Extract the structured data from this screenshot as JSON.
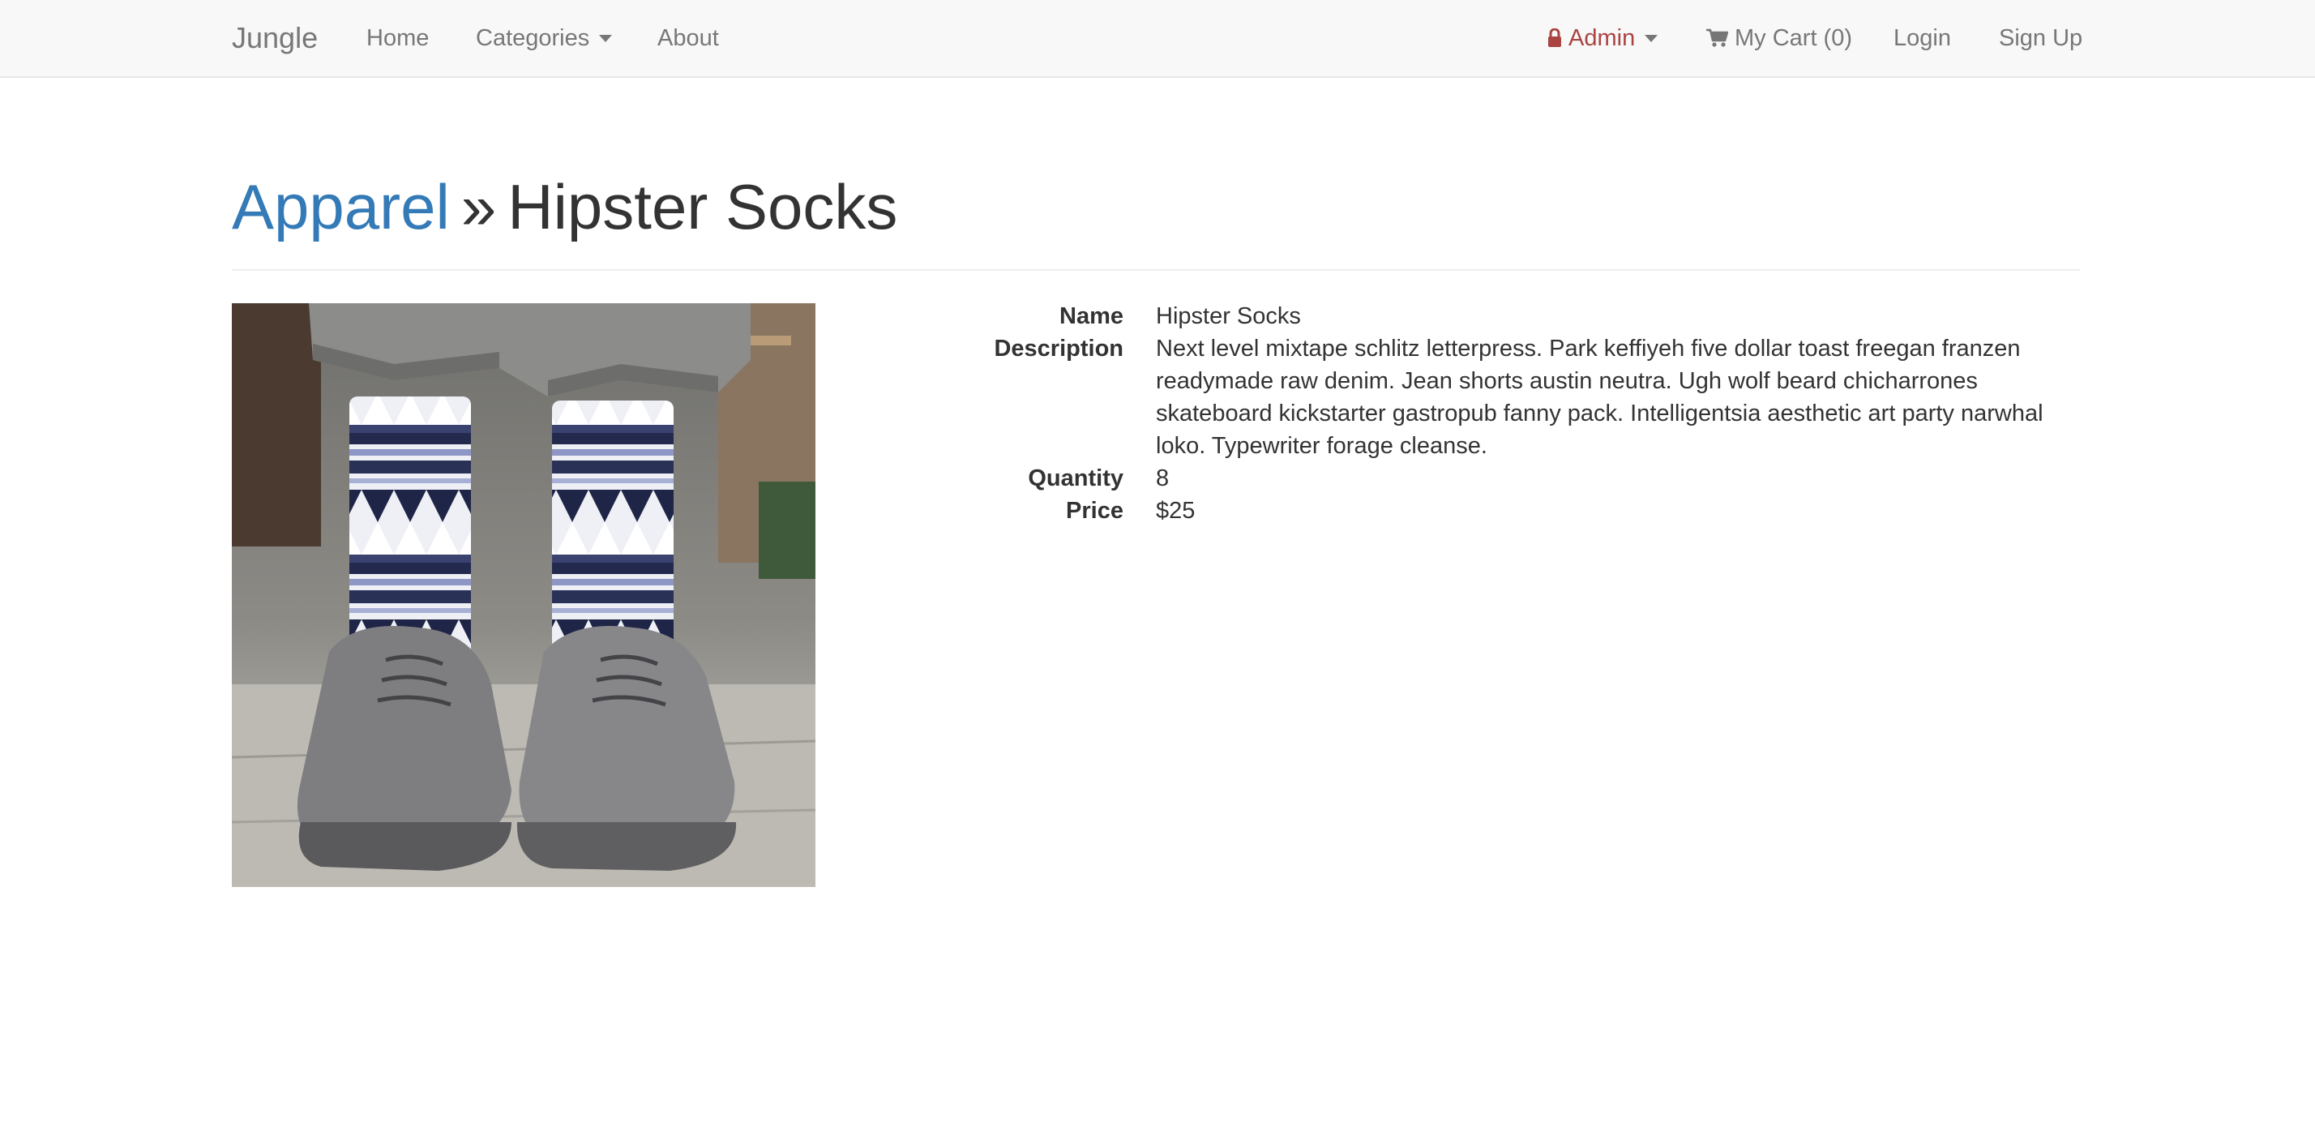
{
  "navbar": {
    "brand": "Jungle",
    "home": "Home",
    "categories": "Categories",
    "about": "About",
    "admin": "Admin",
    "cart": "My Cart (0)",
    "login": "Login",
    "signup": "Sign Up"
  },
  "breadcrumb": {
    "category": "Apparel",
    "separator": "»",
    "product": "Hipster Socks"
  },
  "product": {
    "image_alt": "Hipster Socks",
    "fields": [
      {
        "label": "Name",
        "value": "Hipster Socks"
      },
      {
        "label": "Description",
        "value": "Next level mixtape schlitz letterpress. Park keffiyeh five dollar toast freegan franzen readymade raw denim. Jean shorts austin neutra. Ugh wolf beard chicharrones skateboard kickstarter gastropub fanny pack. Intelligentsia aesthetic art party narwhal loko. Typewriter forage cleanse."
      },
      {
        "label": "Quantity",
        "value": "8"
      },
      {
        "label": "Price",
        "value": "$25"
      }
    ]
  },
  "icons": {
    "lock": "lock-icon",
    "cart": "shopping-cart-icon",
    "dropdown": "caret-down-icon"
  },
  "colors": {
    "link": "#337ab7",
    "admin": "#a94442",
    "navbar_bg": "#f8f8f8",
    "nav_text": "#777777"
  }
}
